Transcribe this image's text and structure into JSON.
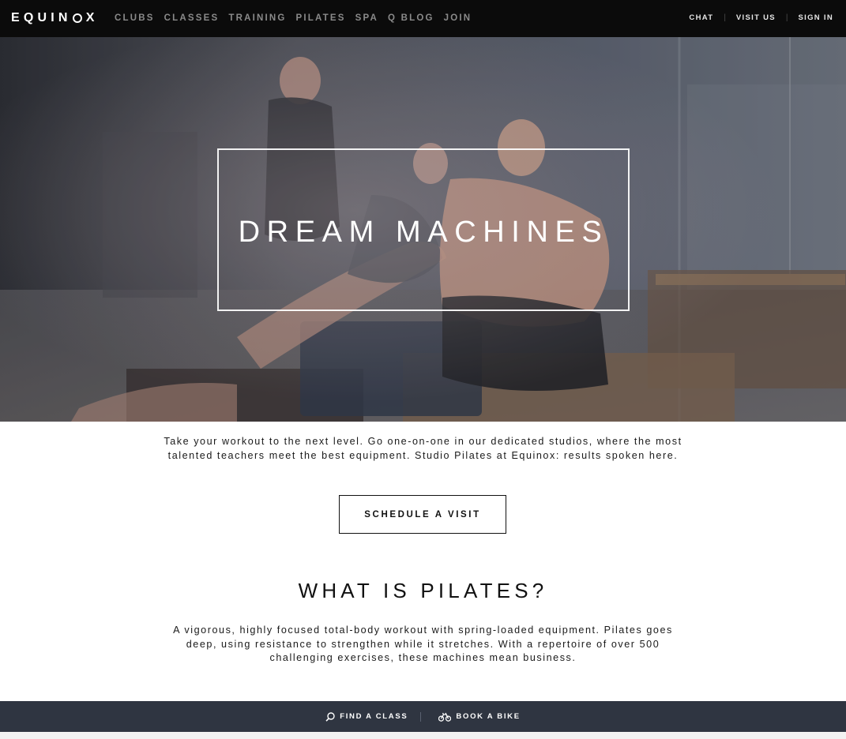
{
  "nav": {
    "logo_text": "EQUINOX",
    "main_items": [
      "CLUBS",
      "CLASSES",
      "TRAINING",
      "PILATES",
      "SPA",
      "Q BLOG",
      "JOIN"
    ],
    "util_items": [
      "CHAT",
      "VISIT US",
      "SIGN IN"
    ]
  },
  "hero": {
    "title": "DREAM MACHINES"
  },
  "intro": {
    "text": "Take your workout to the next level. Go one-on-one in our dedicated studios, where the most talented teachers meet the best equipment. Studio Pilates at Equinox: results spoken here."
  },
  "cta": {
    "label": "SCHEDULE A VISIT"
  },
  "section": {
    "heading": "WHAT IS PILATES?",
    "body": "A vigorous, highly focused total-body workout with spring-loaded equipment. Pilates goes deep, using resistance to strengthen while it stretches. With a repertoire of over 500 challenging exercises, these machines mean business."
  },
  "bottom_bar": {
    "find_class": "FIND A CLASS",
    "book_bike": "BOOK A BIKE",
    "find_class_icon": "search-icon",
    "book_bike_icon": "bike-icon"
  },
  "colors": {
    "nav_bg": "#0b0b0b",
    "bottom_bar_bg": "#2f3541",
    "nav_text": "#8a8a8a"
  }
}
